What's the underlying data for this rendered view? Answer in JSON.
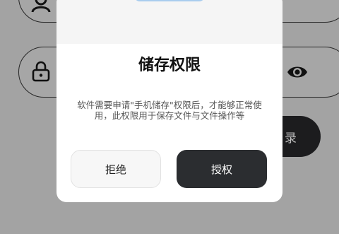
{
  "background": {
    "login_button_label": "录"
  },
  "dialog": {
    "title": "储存权限",
    "message": "软件需要申请\"手机储存\"权限后，才能够正常使用，此权限用于保存文件与文件操作等",
    "deny_label": "拒绝",
    "grant_label": "授权"
  },
  "colors": {
    "primary_button": "#2b2d30",
    "overlay": "#a3a3a3",
    "illustration": "#a9cdee"
  },
  "icons": [
    "user-icon",
    "lock-icon",
    "eye-icon"
  ]
}
